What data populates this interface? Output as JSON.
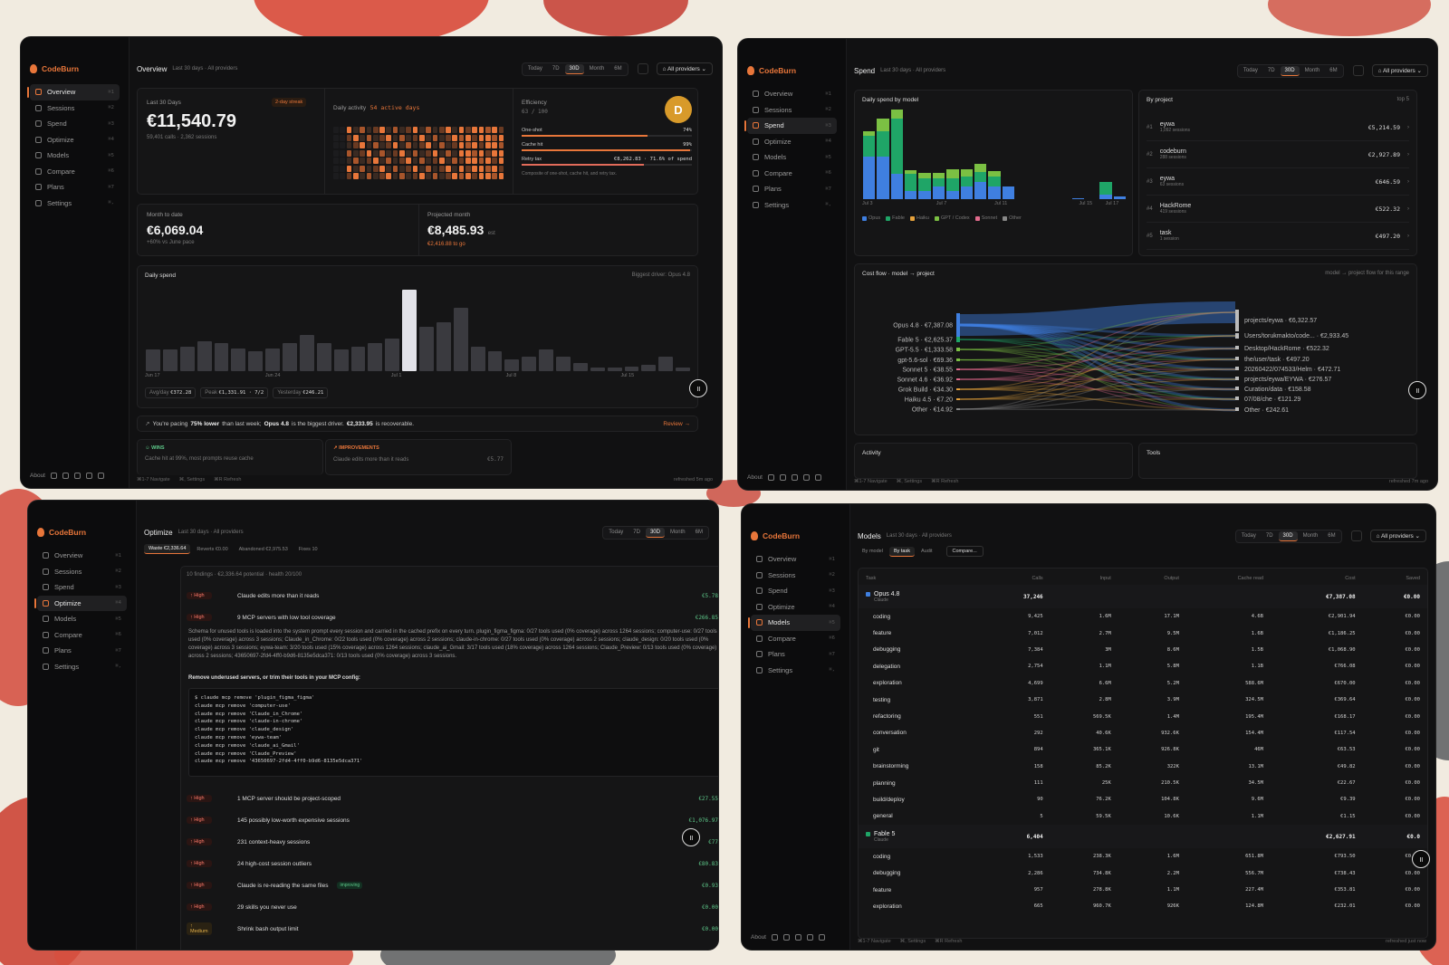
{
  "brand": "CodeBurn",
  "nav": [
    {
      "label": "Overview",
      "kbd": "⌘1"
    },
    {
      "label": "Sessions",
      "kbd": "⌘2"
    },
    {
      "label": "Spend",
      "kbd": "⌘3"
    },
    {
      "label": "Optimize",
      "kbd": "⌘4"
    },
    {
      "label": "Models",
      "kbd": "⌘5"
    },
    {
      "label": "Compare",
      "kbd": "⌘6"
    },
    {
      "label": "Plans",
      "kbd": "⌘7"
    },
    {
      "label": "Settings",
      "kbd": "⌘,"
    }
  ],
  "header_sub": "Last 30 days · All providers",
  "ranges": [
    "Today",
    "7D",
    "30D",
    "Month",
    "6M"
  ],
  "providers": "All providers",
  "footer": {
    "about": "About",
    "navigate": "⌘1-7 Navigate",
    "settings": "⌘, Settings",
    "refresh": "⌘R Refresh"
  },
  "overview": {
    "title": "Overview",
    "last30_label": "Last 30 Days",
    "streak": "2-day streak",
    "total": "€11,540.79",
    "total_sub": "59,401 calls · 2,362 sessions",
    "activity_label": "Daily activity",
    "activity_days": "54 active days",
    "efficiency_label": "Efficiency",
    "efficiency_score": "63 / 100",
    "grade": "D",
    "one_shot_label": "One-shot",
    "one_shot_val": "74%",
    "one_shot_pct": 0.74,
    "cache_label": "Cache hit",
    "cache_val": "99%",
    "cache_pct": 0.99,
    "retry_label": "Retry tax",
    "retry_val": "€8,262.83 · 71.6% of spend",
    "retry_pct": 0.716,
    "eff_note": "Composite of one-shot, cache hit, and retry tax.",
    "mtd_label": "Month to date",
    "mtd": "€6,069.04",
    "mtd_sub": "+60% vs June pace",
    "proj_label": "Projected month",
    "proj": "€8,485.93",
    "proj_est": "est",
    "proj_sub": "€2,416.88 to go",
    "daily_label": "Daily spend",
    "driver": "Biggest driver: Opus 4.8",
    "daily_values": [
      0.27,
      0.27,
      0.3,
      0.37,
      0.35,
      0.28,
      0.25,
      0.28,
      0.35,
      0.44,
      0.35,
      0.27,
      0.3,
      0.35,
      0.4,
      1.0,
      0.55,
      0.6,
      0.78,
      0.3,
      0.25,
      0.15,
      0.18,
      0.27,
      0.18,
      0.1,
      0.05,
      0.04,
      0.06,
      0.08,
      0.18,
      0.05
    ],
    "daily_ticks": [
      "Jun 17",
      "Jun 24",
      "Jul 1",
      "Jul 8",
      "Jul 15"
    ],
    "avg_label": "Avg/day",
    "avg": "€372.28",
    "peak_label": "Peak",
    "peak": "€1,331.91 · 7/2",
    "yest_label": "Yesterday",
    "yest": "€246.21",
    "pace_a": "You're pacing",
    "pace_b": "75% lower",
    "pace_c": "than last week;",
    "pace_d": "Opus 4.8",
    "pace_e": "is the biggest driver.",
    "pace_f": "€2,333.95",
    "pace_g": "is recoverable.",
    "review": "Review →",
    "wins": "WINS",
    "wins_text": "Cache hit at 99%, most prompts reuse cache",
    "improve": "IMPROVEMENTS",
    "improve_text": "Claude edits more than it reads",
    "improve_val": "€5.77",
    "refreshed": "refreshed 5m ago"
  },
  "spend": {
    "title": "Spend",
    "daily_by_model": "Daily spend by model",
    "legend": [
      {
        "name": "Opus",
        "color": "#3f7fe0"
      },
      {
        "name": "Fable",
        "color": "#1fa567"
      },
      {
        "name": "Haiku",
        "color": "#e6a23c"
      },
      {
        "name": "GPT / Codex",
        "color": "#7bc043"
      },
      {
        "name": "Sonnet",
        "color": "#e16b8c"
      },
      {
        "name": "Other",
        "color": "#888888"
      }
    ],
    "ticks": [
      "Jul 3",
      "Jul 7",
      "Jul 11",
      "Jul 15",
      "Jul 17"
    ],
    "by_project": "By project",
    "top": "top 5",
    "projects": [
      {
        "rank": "#1",
        "name": "eywa",
        "sessions": "1,092 sessions",
        "cost": "€5,214.59"
      },
      {
        "rank": "#2",
        "name": "codeburn",
        "sessions": "288 sessions",
        "cost": "€2,927.89"
      },
      {
        "rank": "#3",
        "name": "eywa",
        "sessions": "63 sessions",
        "cost": "€646.59"
      },
      {
        "rank": "#4",
        "name": "HackRome",
        "sessions": "419 sessions",
        "cost": "€522.32"
      },
      {
        "rank": "#5",
        "name": "task",
        "sessions": "1 session",
        "cost": "€497.20"
      }
    ],
    "costflow": "Cost flow · model → project",
    "costflow_note": "model → project flow for this range",
    "flow_left": [
      {
        "label": "Opus 4.8 · €7,387.08",
        "color": "#3f7fe0"
      },
      {
        "label": "Fable 5 · €2,625.37",
        "color": "#1fa567"
      },
      {
        "label": "GPT-5.5 · €1,333.58",
        "color": "#7bc043"
      },
      {
        "label": "gpt-5.6-sol · €69.36",
        "color": "#7bc043"
      },
      {
        "label": "Sonnet 5 · €38.55",
        "color": "#e16b8c"
      },
      {
        "label": "Sonnet 4.6 · €36.92",
        "color": "#e16b8c"
      },
      {
        "label": "Grok Build · €34.30",
        "color": "#e6a23c"
      },
      {
        "label": "Haiku 4.5 · €7.20",
        "color": "#e6a23c"
      },
      {
        "label": "Other · €14.92",
        "color": "#888888"
      }
    ],
    "flow_right": [
      "projects/eywa · €6,322.57",
      "Users/torukmakto/code... · €2,933.45",
      "Desktop/HackRome · €522.32",
      "the/user/task · €497.20",
      "20260422/074533/Helm · €472.71",
      "projects/eywa/EYWA · €276.57",
      "Curation/data · €158.58",
      "07/08/che · €121.29",
      "Other · €242.61"
    ],
    "activity": "Activity",
    "tools": "Tools",
    "refreshed": "refreshed 7m ago"
  },
  "optimize": {
    "title": "Optimize",
    "tabs": [
      "Waste €2,336.64",
      "Reverts €0.00",
      "Abandoned €2,975.53",
      "Fixes 10"
    ],
    "summary": "10 findings · €2,336.64 potential · health 20/100",
    "findings_top": [
      {
        "sev": "High",
        "title": "Claude edits more than it reads",
        "val": "€5.78"
      },
      {
        "sev": "High",
        "title": "9 MCP servers with low tool coverage",
        "val": "€266.85"
      }
    ],
    "detail": "Schema for unused tools is loaded into the system prompt every session and carried in the cached prefix on every turn. plugin_figma_figma: 0/27 tools used (0% coverage) across 1264 sessions; computer-use: 0/27 tools used (0% coverage) across 3 sessions; Claude_in_Chrome: 0/22 tools used (0% coverage) across 2 sessions; claude-in-chrome: 0/27 tools used (0% coverage) across 2 sessions; claude_design: 0/20 tools used (0% coverage) across 3 sessions; eywa-team: 3/20 tools used (15% coverage) across 1264 sessions; claude_ai_Gmail: 3/17 tools used (18% coverage) across 1264 sessions; Claude_Preview: 0/13 tools used (0% coverage) across 2 sessions; 43650697-2fd4-4ff0-b9d6-8135e5dca371: 0/13 tools used (0% coverage) across 3 sessions.",
    "remove_hint": "Remove underused servers, or trim their tools in your MCP config:",
    "code": [
      "$ claude mcp remove 'plugin_figma_figma'",
      "claude mcp remove 'computer-use'",
      "claude mcp remove 'Claude_in_Chrome'",
      "claude mcp remove 'claude-in-chrome'",
      "claude mcp remove 'claude_design'",
      "claude mcp remove 'eywa-team'",
      "claude mcp remove 'claude_ai_Gmail'",
      "claude mcp remove 'Claude_Preview'",
      "claude mcp remove '43650697-2fd4-4ff0-b9d6-8135e5dca371'"
    ],
    "findings": [
      {
        "sev": "High",
        "title": "1 MCP server should be project-scoped",
        "val": "€27.55",
        "tag": ""
      },
      {
        "sev": "High",
        "title": "145 possibly low-worth expensive sessions",
        "val": "€1,076.97",
        "tag": ""
      },
      {
        "sev": "High",
        "title": "231 context-heavy sessions",
        "val": "€77",
        "tag": ""
      },
      {
        "sev": "High",
        "title": "24 high-cost session outliers",
        "val": "€80.83",
        "tag": ""
      },
      {
        "sev": "High",
        "title": "Claude is re-reading the same files",
        "val": "€0.93",
        "tag": "improving"
      },
      {
        "sev": "High",
        "title": "29 skills you never use",
        "val": "€0.00",
        "tag": ""
      },
      {
        "sev": "Medium",
        "title": "Shrink bash output limit",
        "val": "€0.00",
        "tag": ""
      }
    ]
  },
  "models": {
    "title": "Models",
    "tabs": [
      "By model",
      "By task",
      "Audit"
    ],
    "compare": "Compare...",
    "cols": [
      "Task",
      "Calls",
      "Input",
      "Output",
      "Cache read",
      "Cost",
      "Saved"
    ],
    "groups": [
      {
        "name": "Opus 4.8",
        "vendor": "Claude",
        "color": "#3f7fe0",
        "calls": "37,246",
        "cost": "€7,387.08",
        "saved": "€0.00",
        "rows": [
          [
            "coding",
            "9,425",
            "1.6M",
            "17.1M",
            "4.6B",
            "€2,901.94",
            "€0.00"
          ],
          [
            "feature",
            "7,012",
            "2.7M",
            "9.5M",
            "1.6B",
            "€1,186.25",
            "€0.00"
          ],
          [
            "debugging",
            "7,384",
            "3M",
            "8.6M",
            "1.5B",
            "€1,068.90",
            "€0.00"
          ],
          [
            "delegation",
            "2,754",
            "1.1M",
            "5.8M",
            "1.1B",
            "€766.08",
            "€0.00"
          ],
          [
            "exploration",
            "4,699",
            "6.6M",
            "5.2M",
            "588.6M",
            "€670.00",
            "€0.00"
          ],
          [
            "testing",
            "3,871",
            "2.8M",
            "3.9M",
            "324.5M",
            "€369.64",
            "€0.00"
          ],
          [
            "refactoring",
            "551",
            "569.5K",
            "1.4M",
            "195.4M",
            "€168.17",
            "€0.00"
          ],
          [
            "conversation",
            "292",
            "40.6K",
            "932.6K",
            "154.4M",
            "€117.54",
            "€0.00"
          ],
          [
            "git",
            "894",
            "365.1K",
            "926.8K",
            "46M",
            "€63.53",
            "€0.00"
          ],
          [
            "brainstorming",
            "158",
            "85.2K",
            "322K",
            "13.1M",
            "€49.82",
            "€0.00"
          ],
          [
            "planning",
            "111",
            "25K",
            "210.5K",
            "34.5M",
            "€22.67",
            "€0.00"
          ],
          [
            "build/deploy",
            "90",
            "76.2K",
            "104.8K",
            "9.6M",
            "€9.39",
            "€0.00"
          ],
          [
            "general",
            "5",
            "59.5K",
            "10.6K",
            "1.1M",
            "€1.15",
            "€0.00"
          ]
        ]
      },
      {
        "name": "Fable 5",
        "vendor": "Claude",
        "color": "#1fa567",
        "calls": "6,404",
        "cost": "€2,627.91",
        "saved": "€0.0",
        "rows": [
          [
            "coding",
            "1,533",
            "238.3K",
            "1.6M",
            "651.8M",
            "€793.50",
            "€0.00"
          ],
          [
            "debugging",
            "2,286",
            "734.8K",
            "2.2M",
            "556.7M",
            "€738.43",
            "€0.00"
          ],
          [
            "feature",
            "957",
            "278.8K",
            "1.1M",
            "227.4M",
            "€353.81",
            "€0.00"
          ],
          [
            "exploration",
            "665",
            "960.7K",
            "926K",
            "124.8M",
            "€232.01",
            "€0.00"
          ]
        ]
      }
    ],
    "refreshed": "refreshed just now"
  },
  "colors": {
    "accent": "#e8763a",
    "bar": "#3a3a3f",
    "peak": "#e2e2e8"
  }
}
